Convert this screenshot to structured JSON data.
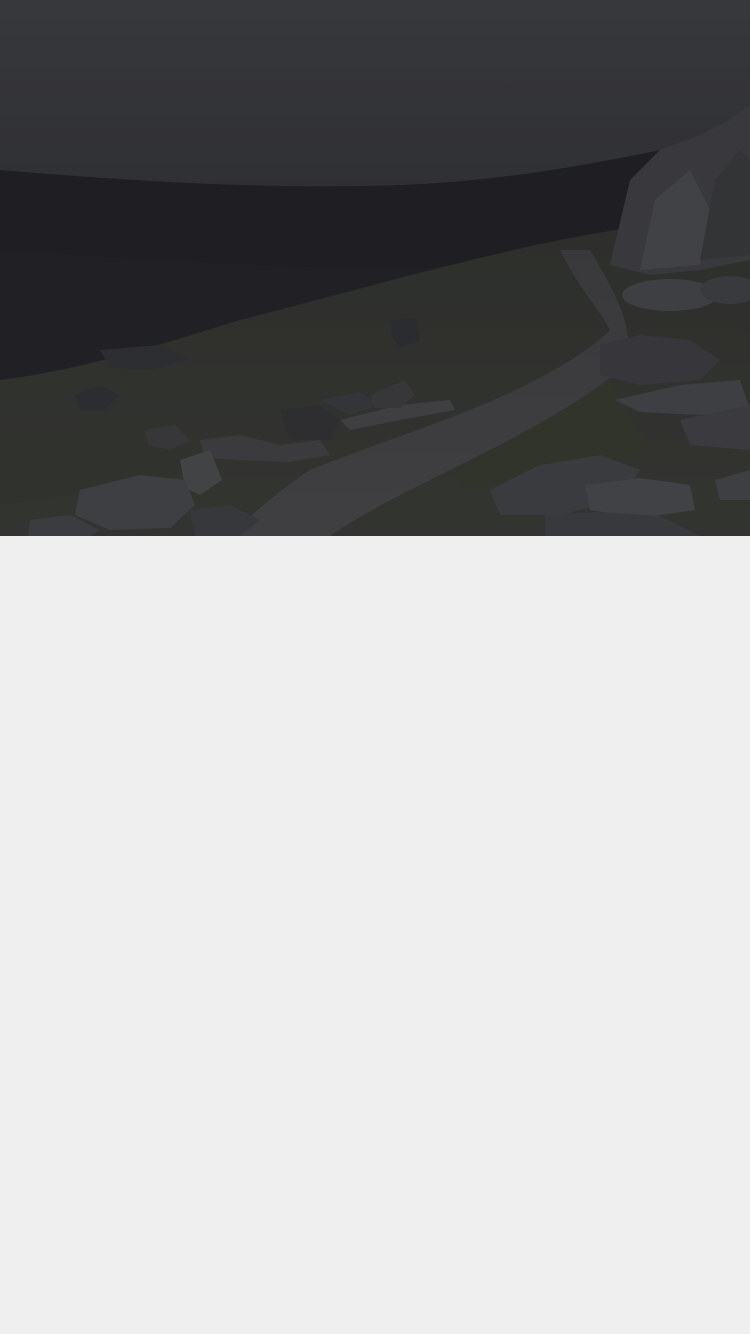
{
  "colors": {
    "sky_top": "#4a4b50",
    "sky_bottom": "#2a2b2f",
    "valley": "#26272a",
    "hillside": "#3e4038",
    "path": "#4a4a4c",
    "rock": "#55565a",
    "rock_dark": "#3a3b3e",
    "page_background": "#efefef"
  },
  "hero": {
    "description_icon": "mountain-landscape-photo"
  }
}
